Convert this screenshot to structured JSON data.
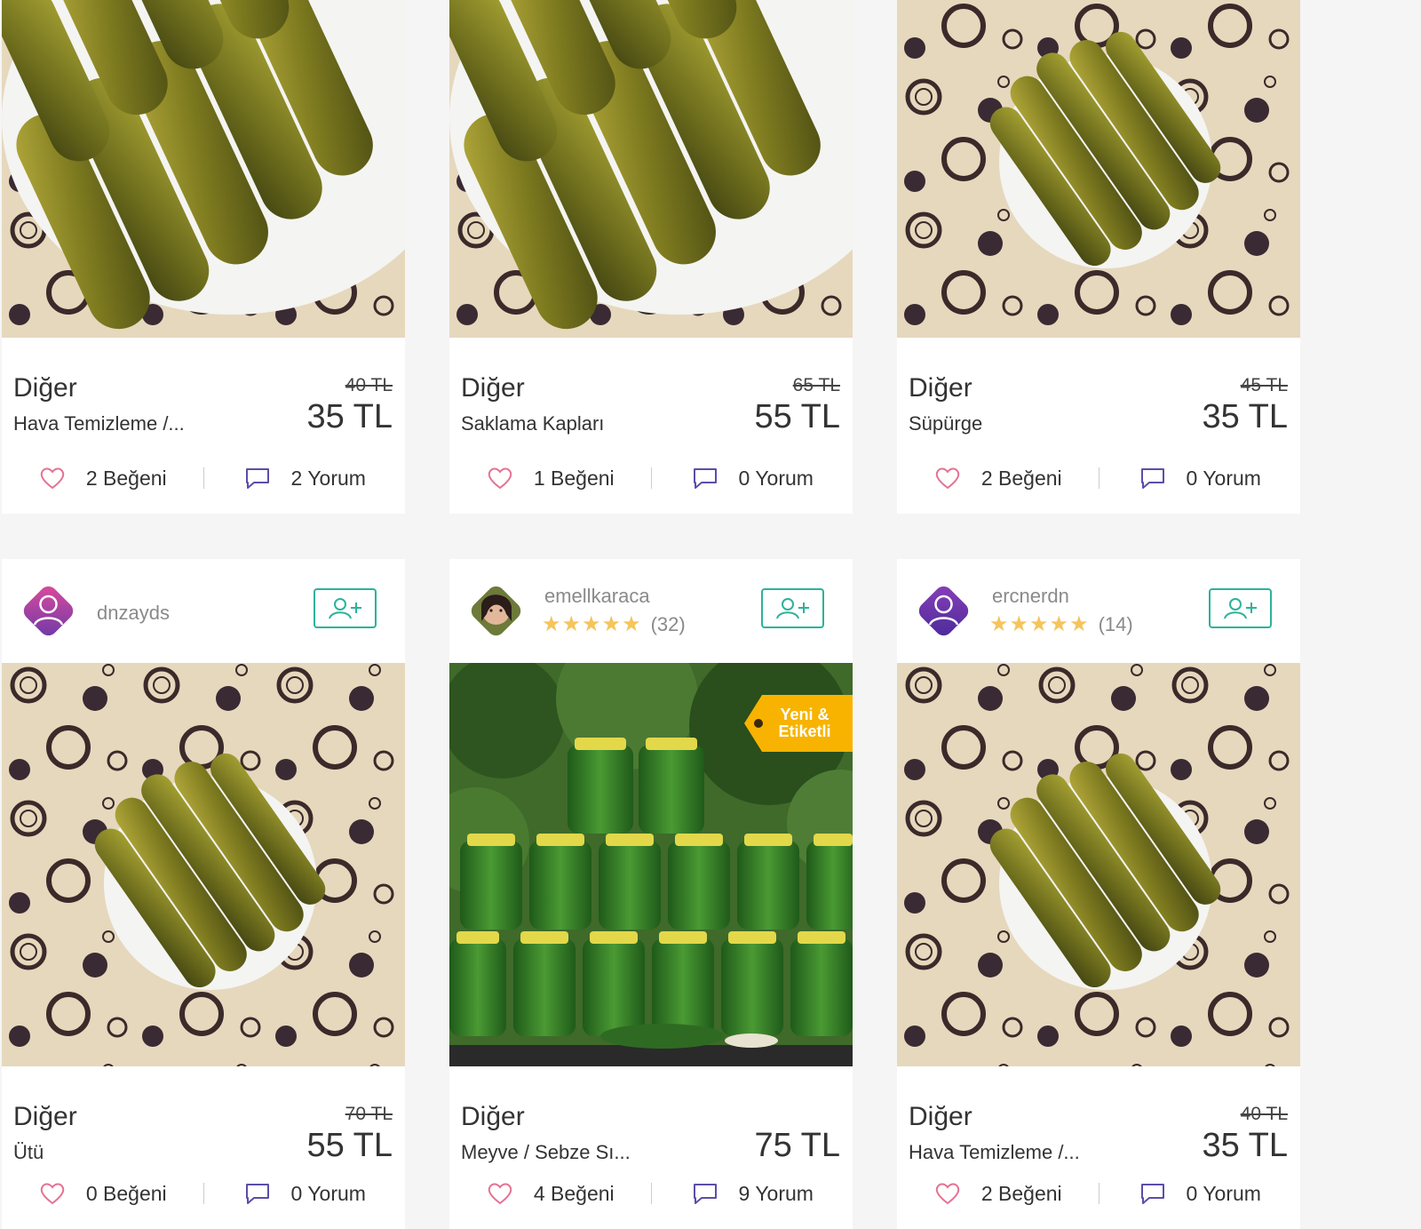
{
  "colors": {
    "accent": "#2bb39a",
    "heart": "#e57393",
    "comment": "#5b4ea8",
    "star": "#f5c45c",
    "badge": "#f8b300"
  },
  "follow_icon": "user-plus-icon",
  "cards": [
    {
      "category": "Diğer",
      "subcategory": "Hava Temizleme /...",
      "old_price": "40 TL",
      "price": "35 TL",
      "likes": "2 Beğeni",
      "comments": "2 Yorum",
      "photo": "pickles-plate-close"
    },
    {
      "category": "Diğer",
      "subcategory": "Saklama Kapları",
      "old_price": "65 TL",
      "price": "55 TL",
      "likes": "1 Beğeni",
      "comments": "0 Yorum",
      "photo": "pickles-plate-close"
    },
    {
      "category": "Diğer",
      "subcategory": "Süpürge",
      "old_price": "45 TL",
      "price": "35 TL",
      "likes": "2 Beğeni",
      "comments": "0 Yorum",
      "photo": "pickles-plate-pattern"
    },
    {
      "seller": {
        "name": "dnzayds",
        "avatar": "default-avatar-pink"
      },
      "category": "Diğer",
      "subcategory": "Ütü",
      "old_price": "70 TL",
      "price": "55 TL",
      "likes": "0 Beğeni",
      "comments": "0 Yorum",
      "photo": "pickles-plate-pattern"
    },
    {
      "seller": {
        "name": "emellkaraca",
        "avatar": "user-photo",
        "rating": 5,
        "rating_count": "(32)"
      },
      "badge": {
        "line1": "Yeni &",
        "line2": "Etiketli"
      },
      "category": "Diğer",
      "subcategory": "Meyve / Sebze Sı...",
      "old_price": "",
      "price": "75 TL",
      "likes": "4 Beğeni",
      "comments": "9 Yorum",
      "photo": "pickle-jars-stack"
    },
    {
      "seller": {
        "name": "ercnerdn",
        "avatar": "default-avatar-purple",
        "rating": 5,
        "rating_count": "(14)"
      },
      "category": "Diğer",
      "subcategory": "Hava Temizleme /...",
      "old_price": "40 TL",
      "price": "35 TL",
      "likes": "2 Beğeni",
      "comments": "0 Yorum",
      "photo": "pickles-plate-pattern"
    }
  ]
}
